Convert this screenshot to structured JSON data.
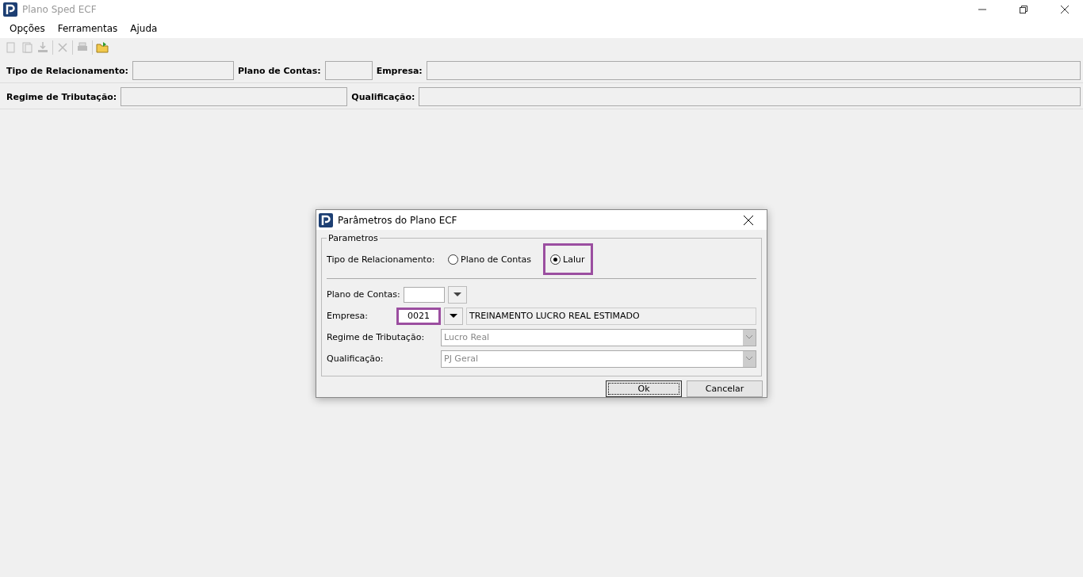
{
  "window": {
    "title": "Plano Sped ECF"
  },
  "menu": [
    "Opções",
    "Ferramentas",
    "Ajuda"
  ],
  "toolbar": [
    {
      "kind": "refresh",
      "disabled": true
    },
    {
      "kind": "copy",
      "disabled": true
    },
    {
      "kind": "download",
      "disabled": true
    },
    {
      "kind": "separator"
    },
    {
      "kind": "delete",
      "disabled": true
    },
    {
      "kind": "separator"
    },
    {
      "kind": "print",
      "disabled": true
    },
    {
      "kind": "separator"
    },
    {
      "kind": "open",
      "disabled": false
    }
  ],
  "header_rows": [
    [
      {
        "label": "Tipo de Relacionamento:"
      },
      {
        "label": "Plano de Contas:"
      },
      {
        "label": "Empresa:"
      }
    ],
    [
      {
        "label": "Regime de Tributação:"
      },
      {
        "label": "Qualificação:"
      }
    ]
  ],
  "dialog": {
    "title": "Parâmetros do Plano ECF",
    "group_title": "Parametros",
    "relationship": {
      "label": "Tipo de Relacionamento:",
      "options": [
        {
          "label": "Plano de Contas",
          "selected": false,
          "highlighted": false
        },
        {
          "label": "Lalur",
          "selected": true,
          "highlighted": true
        }
      ]
    },
    "plano_de_contas": {
      "label": "Plano de Contas:"
    },
    "empresa": {
      "label": "Empresa:",
      "code": "0021",
      "highlighted": true,
      "name": "TREINAMENTO LUCRO REAL ESTIMADO"
    },
    "selects": [
      {
        "label": "Regime de Tributação:",
        "value": "Lucro Real",
        "disabled": true
      },
      {
        "label": "Qualificação:",
        "value": "PJ Geral",
        "disabled": true
      }
    ],
    "buttons": [
      {
        "label": "Ok",
        "default": true
      },
      {
        "label": "Cancelar",
        "default": false
      }
    ]
  }
}
